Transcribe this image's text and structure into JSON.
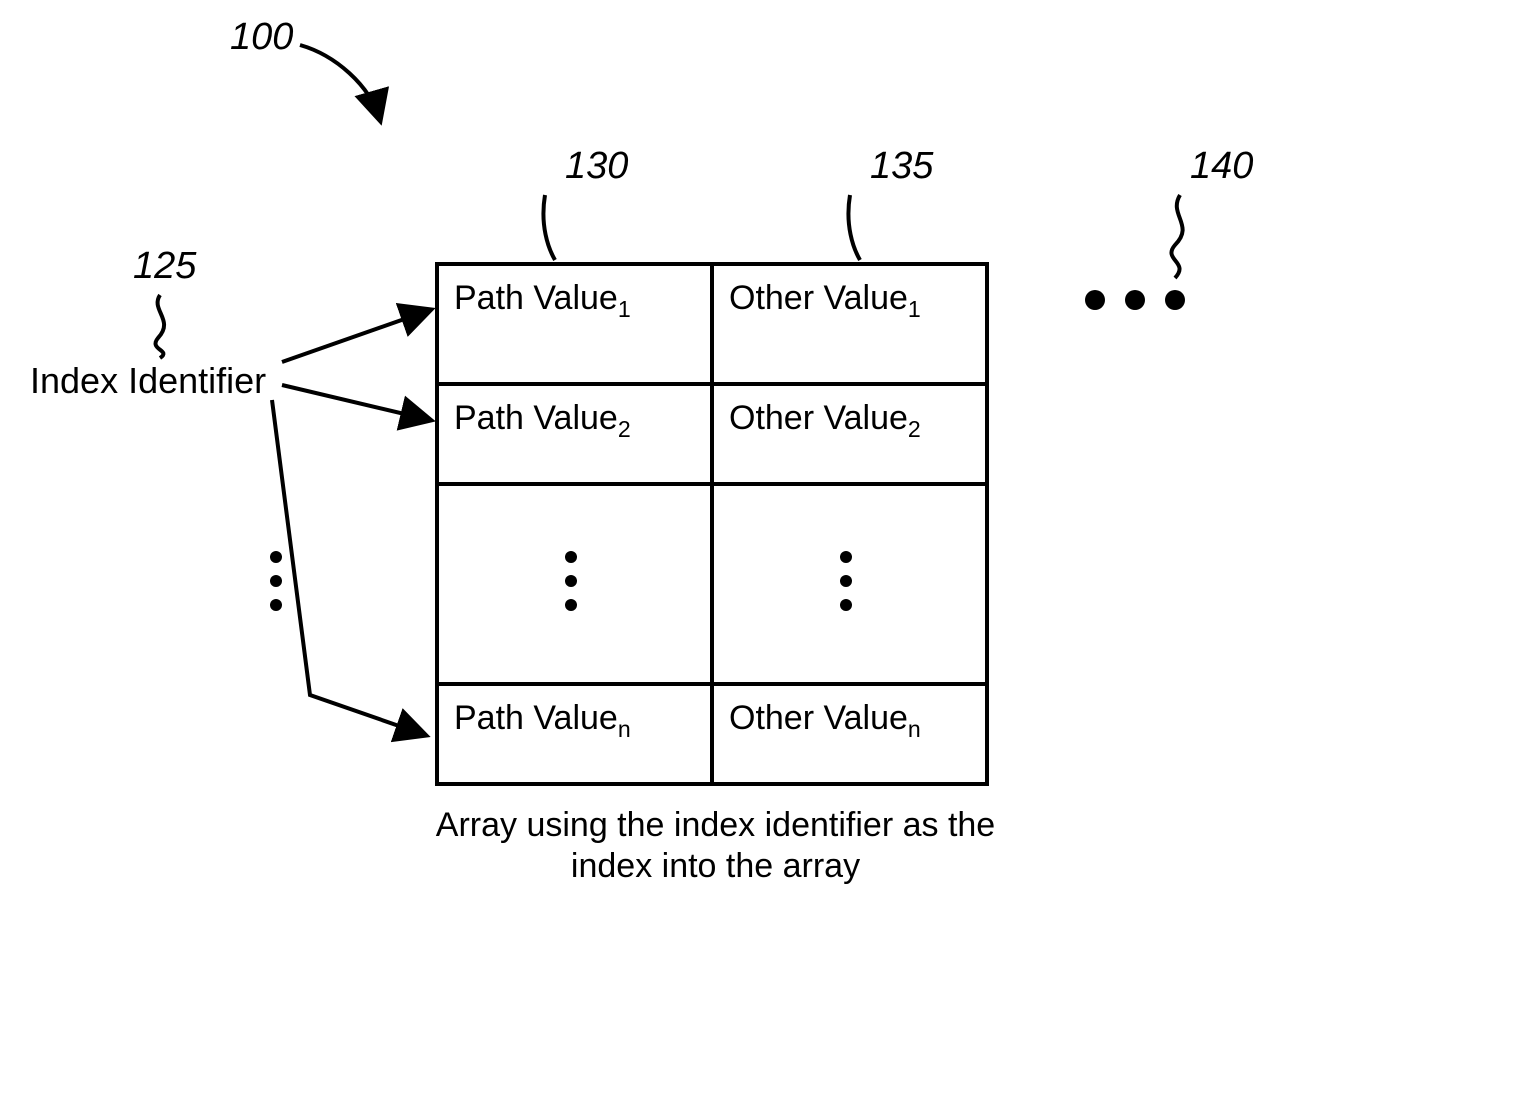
{
  "refs": {
    "fig": "100",
    "index": "125",
    "col1": "130",
    "col2": "135",
    "more": "140"
  },
  "index_label": "Index Identifier",
  "caption_line1": "Array using the index identifier as the",
  "caption_line2": "index into the array",
  "cells": {
    "path1_label": "Path Value",
    "path1_sub": "1",
    "other1_label": "Other Value",
    "other1_sub": "1",
    "path2_label": "Path Value",
    "path2_sub": "2",
    "other2_label": "Other Value",
    "other2_sub": "2",
    "pathn_label": "Path Value",
    "pathn_sub": "n",
    "othern_label": "Other Value",
    "othern_sub": "n"
  }
}
